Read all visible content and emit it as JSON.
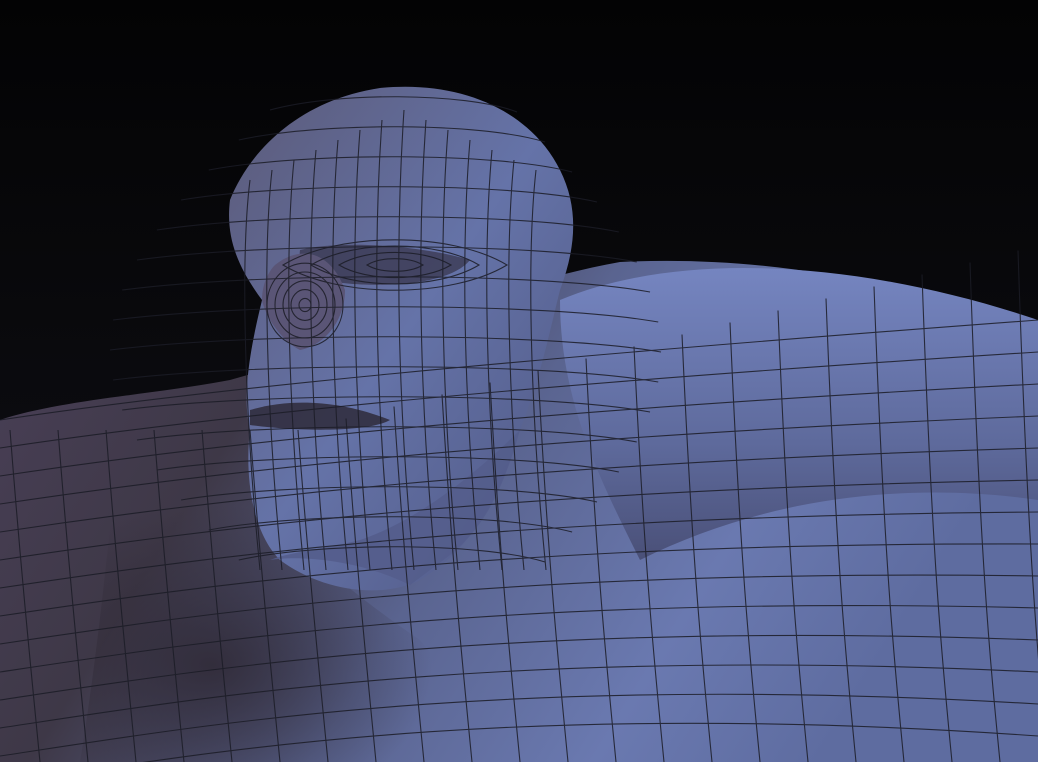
{
  "viewport": {
    "content": "3d-mesh-render",
    "subject": "sculpted-character-bust-wireframe",
    "colors": {
      "background_top": "#030304",
      "background_bottom": "#2a2b33",
      "mesh_light": "#6f7fb8",
      "mesh_mid": "#565f8a",
      "mesh_shadow": "#3c3444",
      "wire": "#1b1c26"
    }
  }
}
